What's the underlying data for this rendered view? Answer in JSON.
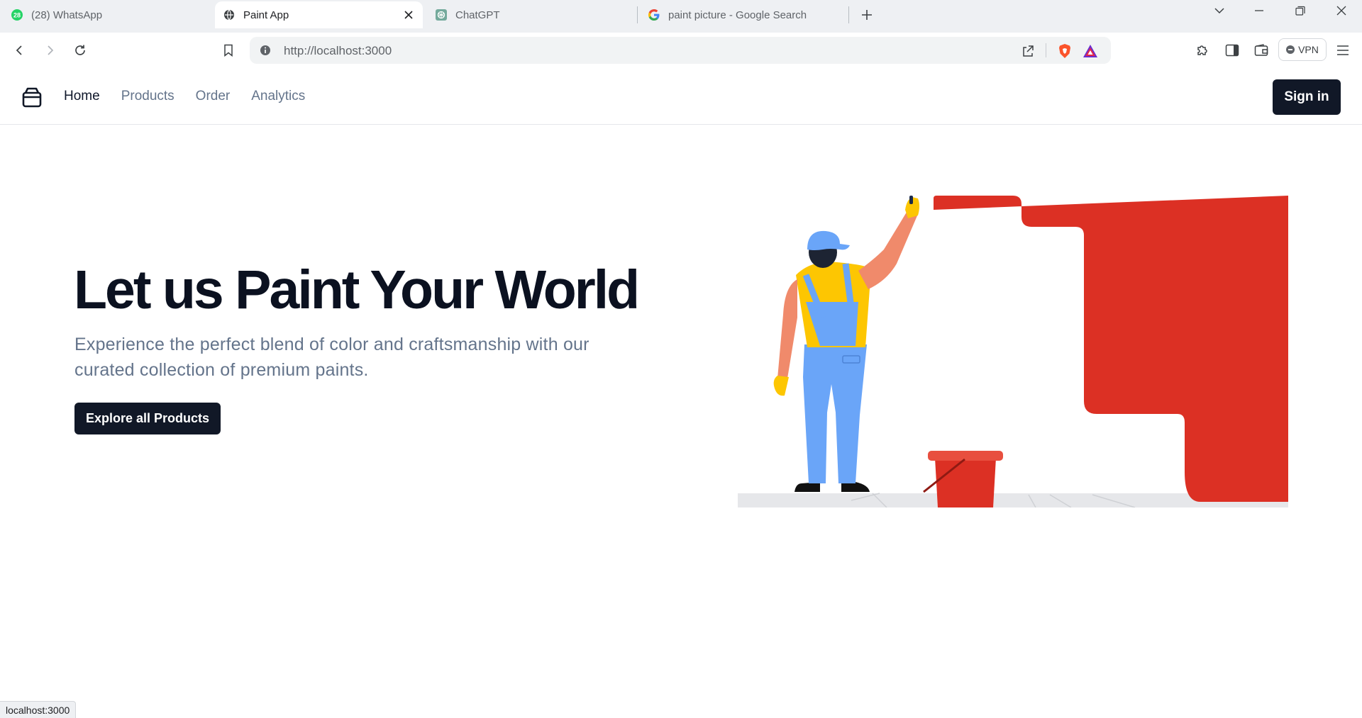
{
  "browser": {
    "tabs": [
      {
        "title": "(28) WhatsApp",
        "badge": "28",
        "icon": "whatsapp-icon",
        "active": false
      },
      {
        "title": "Paint App",
        "icon": "globe-icon",
        "active": true
      },
      {
        "title": "ChatGPT",
        "icon": "chatgpt-icon",
        "active": false
      },
      {
        "title": "paint picture - Google Search",
        "icon": "google-icon",
        "active": false
      }
    ],
    "url": "http://localhost:3000",
    "vpn_label": "VPN",
    "status_url": "localhost:3000"
  },
  "nav": {
    "logo_icon": "bag-icon",
    "links": [
      "Home",
      "Products",
      "Order",
      "Analytics"
    ],
    "active_link": "Home",
    "signin_label": "Sign in"
  },
  "hero": {
    "title": "Let us Paint Your World",
    "subtitle": "Experience the perfect blend of color and craftsmanship with our curated collection of premium paints.",
    "cta_label": "Explore all Products",
    "image": "painter-illustration"
  },
  "colors": {
    "dark": "#111827",
    "paint_red": "#dc3024",
    "overall_blue": "#6aa5f8",
    "shirt_yellow": "#fdc602",
    "muted_text": "#64748b"
  }
}
